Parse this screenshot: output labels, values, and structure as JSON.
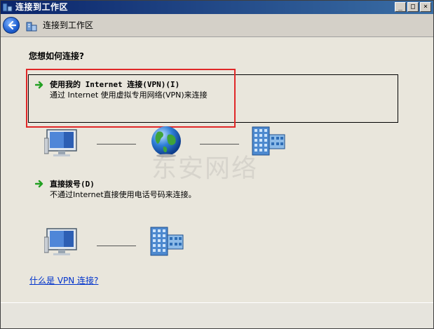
{
  "window": {
    "title": "连接到工作区"
  },
  "titlebar": {
    "minimize": "_",
    "maximize": "□",
    "close": "×"
  },
  "navbar": {
    "title": "连接到工作区"
  },
  "main": {
    "question": "您想如何连接?",
    "option_vpn": {
      "title": "使用我的 Internet 连接(VPN)(I)",
      "description": "通过 Internet 使用虚拟专用网络(VPN)来连接"
    },
    "option_dial": {
      "title": "直接拨号(D)",
      "description": "不通过Internet直接使用电话号码来连接。"
    },
    "help_link": "什么是 VPN 连接?",
    "watermark": "东安网络"
  },
  "colors": {
    "highlight": "#e02828",
    "link": "#0033cc",
    "arrow": "#22a022"
  },
  "icons": {
    "back": "back-arrow-icon",
    "network_computer": "monitor-computer-icon",
    "internet": "globe-icon",
    "workplace": "building-icon"
  }
}
